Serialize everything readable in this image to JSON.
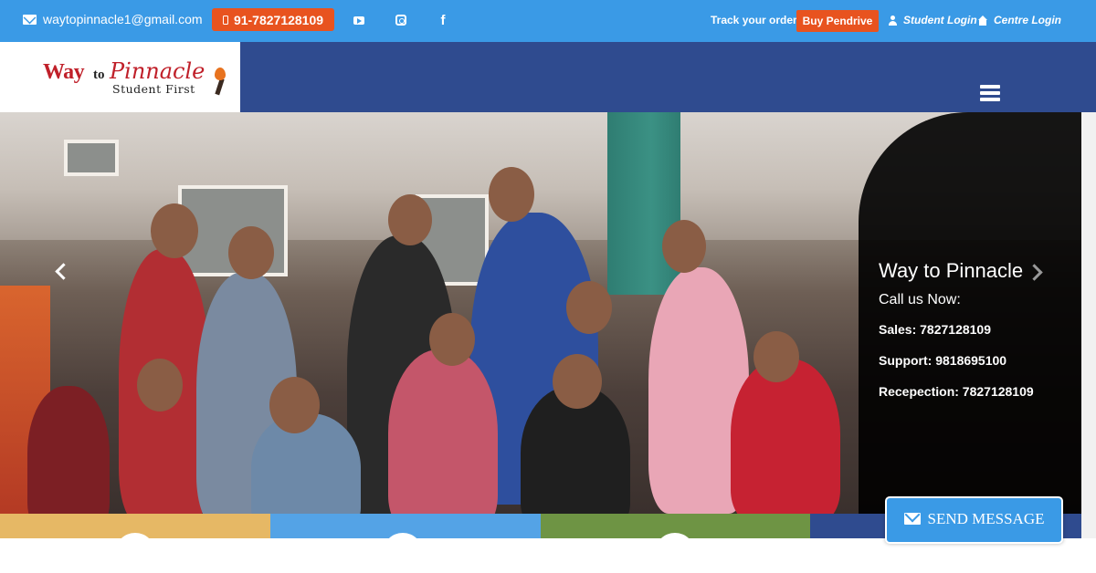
{
  "topbar": {
    "email": "waytopinnacle1@gmail.com",
    "phone": "91-7827128109",
    "social": [
      "youtube-icon",
      "instagram-icon",
      "facebook-icon"
    ],
    "track_label": "Track your order",
    "buy_label": "Buy Pendrive",
    "student_login": "Student Login",
    "centre_login": "Centre Login"
  },
  "logo": {
    "word_way": "Way",
    "word_to": "to",
    "word_pinnacle": "Pinnacle",
    "tagline": "Student First"
  },
  "hero": {
    "title": "Way to Pinnacle",
    "call": "Call us Now:",
    "sales": "Sales: 7827128109",
    "support": "Support: 9818695100",
    "reception": "Recepection: 7827128109"
  },
  "send_message": "SEND MESSAGE",
  "colors": {
    "topbar": "#3a9ae6",
    "header": "#2f4b8f",
    "accent": "#e8531f",
    "strip_yellow": "#e6b865",
    "strip_blue": "#54a3e6",
    "strip_green": "#6e9444",
    "strip_navy": "#2f4b8f"
  }
}
